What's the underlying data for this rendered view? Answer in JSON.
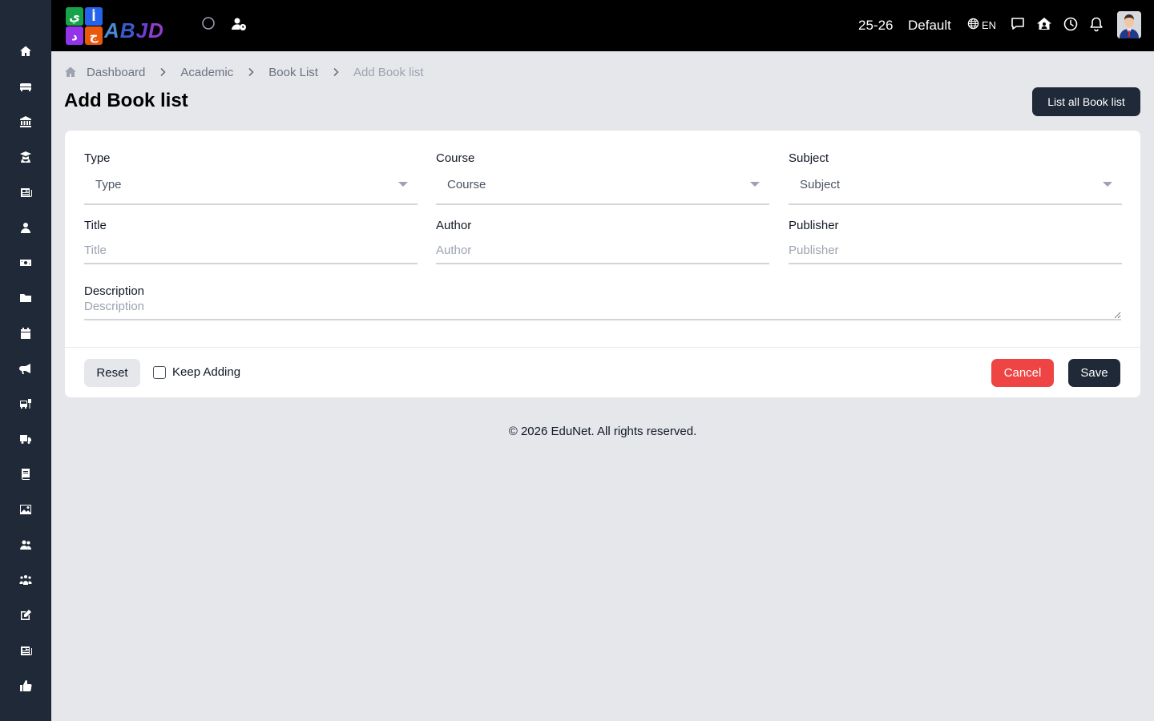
{
  "brand": {
    "logo_text": "ABJD",
    "logo_cells": [
      "ي",
      "أ",
      "د",
      "ج"
    ]
  },
  "header": {
    "session": "25-26",
    "profile": "Default",
    "language": "EN"
  },
  "sidebar": {
    "items": [
      {
        "icon": "home-icon"
      },
      {
        "icon": "sofa-icon"
      },
      {
        "icon": "institution-icon"
      },
      {
        "icon": "graduate-icon"
      },
      {
        "icon": "newspaper-icon"
      },
      {
        "icon": "user-icon"
      },
      {
        "icon": "money-icon"
      },
      {
        "icon": "folder-icon"
      },
      {
        "icon": "calendar-icon"
      },
      {
        "icon": "megaphone-icon"
      },
      {
        "icon": "bus-stop-icon"
      },
      {
        "icon": "truck-icon"
      },
      {
        "icon": "book-icon"
      },
      {
        "icon": "image-icon"
      },
      {
        "icon": "users-icon"
      },
      {
        "icon": "group-icon"
      },
      {
        "icon": "edit-icon"
      },
      {
        "icon": "news-icon"
      },
      {
        "icon": "thumbs-up-icon"
      }
    ]
  },
  "breadcrumb": {
    "items": [
      "Dashboard",
      "Academic",
      "Book List"
    ],
    "current": "Add Book list"
  },
  "page": {
    "title": "Add Book list",
    "list_all_label": "List all Book list"
  },
  "form": {
    "type": {
      "label": "Type",
      "value": "Type"
    },
    "course": {
      "label": "Course",
      "value": "Course"
    },
    "subject": {
      "label": "Subject",
      "value": "Subject"
    },
    "title": {
      "label": "Title",
      "placeholder": "Title"
    },
    "author": {
      "label": "Author",
      "placeholder": "Author"
    },
    "publisher": {
      "label": "Publisher",
      "placeholder": "Publisher"
    },
    "description": {
      "label": "Description",
      "placeholder": "Description"
    },
    "reset_label": "Reset",
    "keep_adding_label": "Keep Adding",
    "cancel_label": "Cancel",
    "save_label": "Save"
  },
  "footer": {
    "text": "© 2026 EduNet. All rights reserved."
  },
  "colors": {
    "sidebar_bg": "#1f2937",
    "header_bg": "#000000",
    "page_bg": "#e5e7eb",
    "primary_button": "#1f2937",
    "cancel_button": "#ef4444"
  }
}
